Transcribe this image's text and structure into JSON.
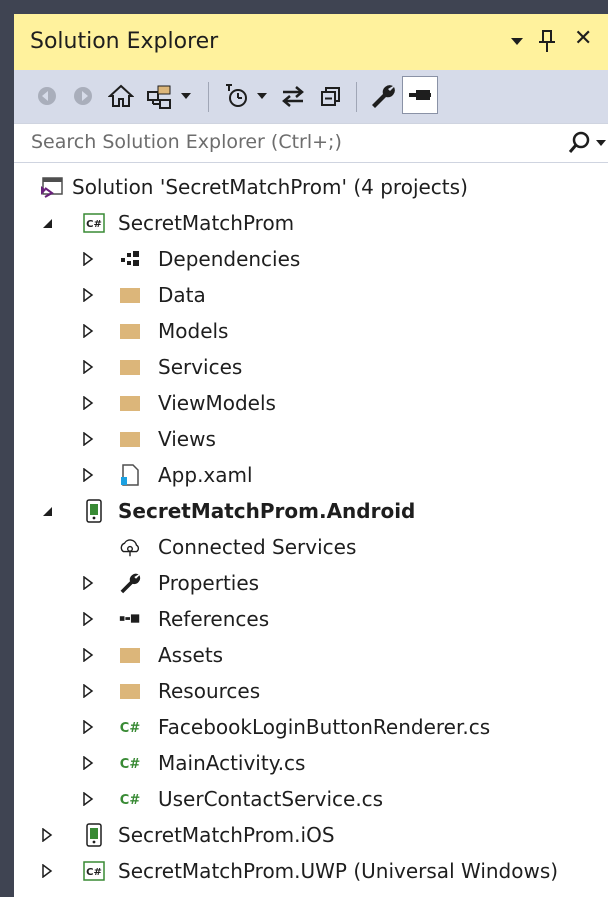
{
  "panel": {
    "title": "Solution Explorer",
    "pin_icon": "pin-icon",
    "close_glyph": "✕"
  },
  "toolbar": {
    "buttons": [
      "back-icon",
      "forward-icon",
      "home-icon",
      "switch-views-icon",
      "dropdown-icon",
      "pending-changes-filter-icon",
      "dropdown-icon",
      "sync-with-document-icon",
      "collapse-all-icon",
      "properties-icon",
      "preview-selected-items-icon"
    ]
  },
  "search": {
    "placeholder": "Search Solution Explorer (Ctrl+;)"
  },
  "tree": {
    "solution": "Solution 'SecretMatchProm' (4 projects)",
    "p1": {
      "name": "SecretMatchProm",
      "items": [
        "Dependencies",
        "Data",
        "Models",
        "Services",
        "ViewModels",
        "Views",
        "App.xaml"
      ]
    },
    "p2": {
      "name": "SecretMatchProm.Android",
      "items": [
        "Connected Services",
        "Properties",
        "References",
        "Assets",
        "Resources",
        "FacebookLoginButtonRenderer.cs",
        "MainActivity.cs",
        "UserContactService.cs"
      ]
    },
    "p3": {
      "name": "SecretMatchProm.iOS"
    },
    "p4": {
      "name": "SecretMatchProm.UWP (Universal Windows)"
    }
  },
  "colors": {
    "title_bg": "#fff29d",
    "toolbar_bg": "#d6dbe9",
    "frame": "#3f4452",
    "folder": "#dcb67a",
    "csharp": "#388a34"
  }
}
